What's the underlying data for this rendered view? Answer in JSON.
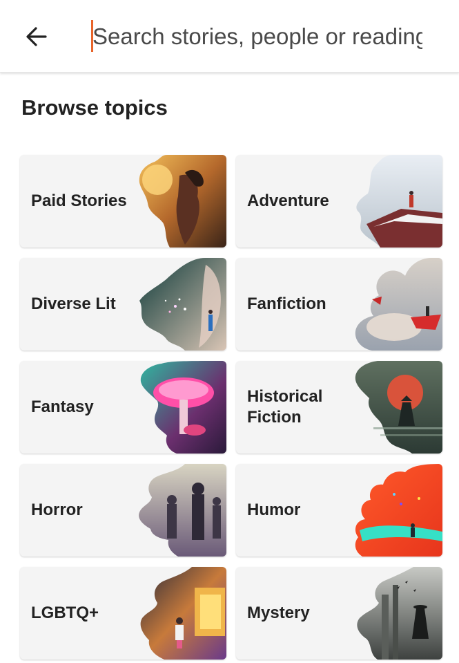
{
  "search": {
    "placeholder": "Search stories, people or reading lists"
  },
  "section_title": "Browse topics",
  "topics": [
    {
      "label": "Paid Stories"
    },
    {
      "label": "Adventure"
    },
    {
      "label": "Diverse Lit"
    },
    {
      "label": "Fanfiction"
    },
    {
      "label": "Fantasy"
    },
    {
      "label": "Historical Fiction"
    },
    {
      "label": "Horror"
    },
    {
      "label": "Humor"
    },
    {
      "label": "LGBTQ+"
    },
    {
      "label": "Mystery"
    }
  ],
  "colors": {
    "caret": "#e8642a",
    "card_bg": "#f4f4f4",
    "text": "#222222"
  }
}
